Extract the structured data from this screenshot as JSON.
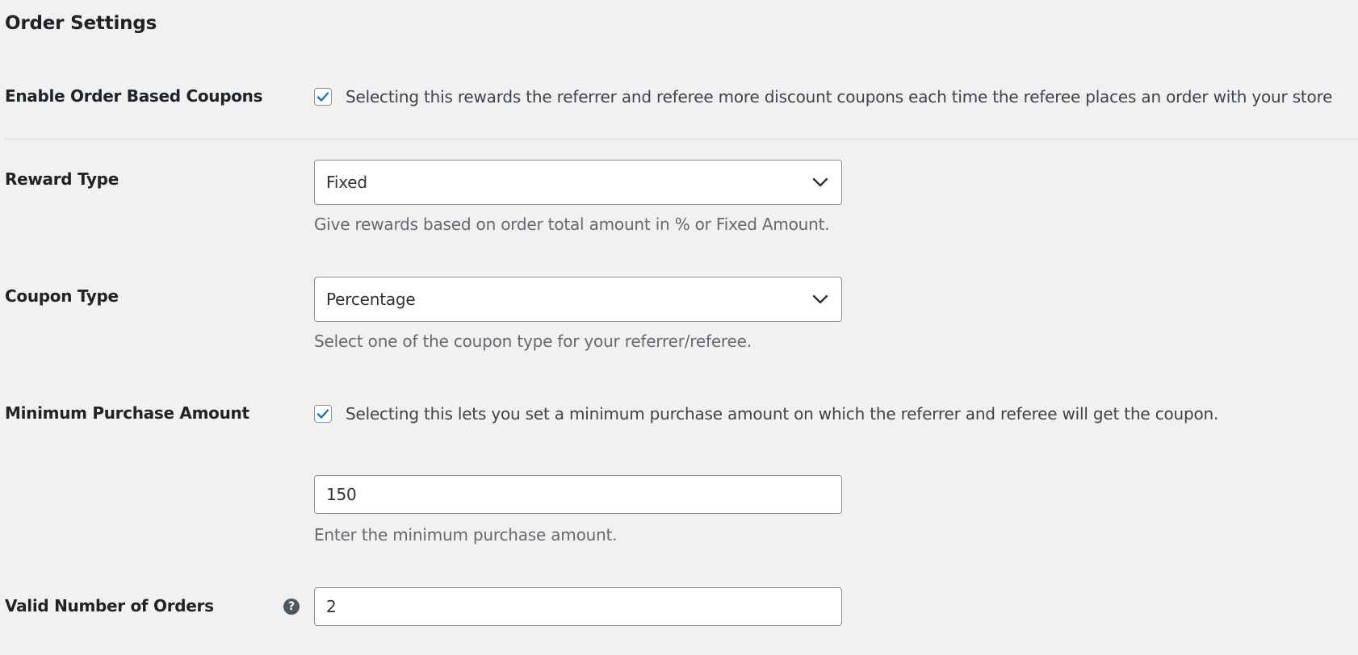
{
  "section": {
    "title": "Order Settings"
  },
  "enable_order_coupons": {
    "label": "Enable Order Based Coupons",
    "checked": true,
    "description": "Selecting this rewards the referrer and referee more discount coupons each time the referee places an order with your store"
  },
  "reward_type": {
    "label": "Reward Type",
    "selected": "Fixed",
    "help": "Give rewards based on order total amount in % or Fixed Amount."
  },
  "coupon_type": {
    "label": "Coupon Type",
    "selected": "Percentage",
    "help": "Select one of the coupon type for your referrer/referee."
  },
  "minimum_purchase": {
    "label": "Minimum Purchase Amount",
    "checked": true,
    "description": "Selecting this lets you set a minimum purchase amount on which the referrer and referee will get the coupon.",
    "value": "150",
    "help": "Enter the minimum purchase amount."
  },
  "valid_orders": {
    "label": "Valid Number of Orders",
    "help_icon_glyph": "?",
    "value": "2"
  },
  "colors": {
    "accent": "#2271b1",
    "background": "#f1f1f1",
    "border": "#8c8f94"
  },
  "icons": {
    "checkbox": "checkmark-icon",
    "select": "chevron-down-icon",
    "help": "question-circle-icon"
  }
}
